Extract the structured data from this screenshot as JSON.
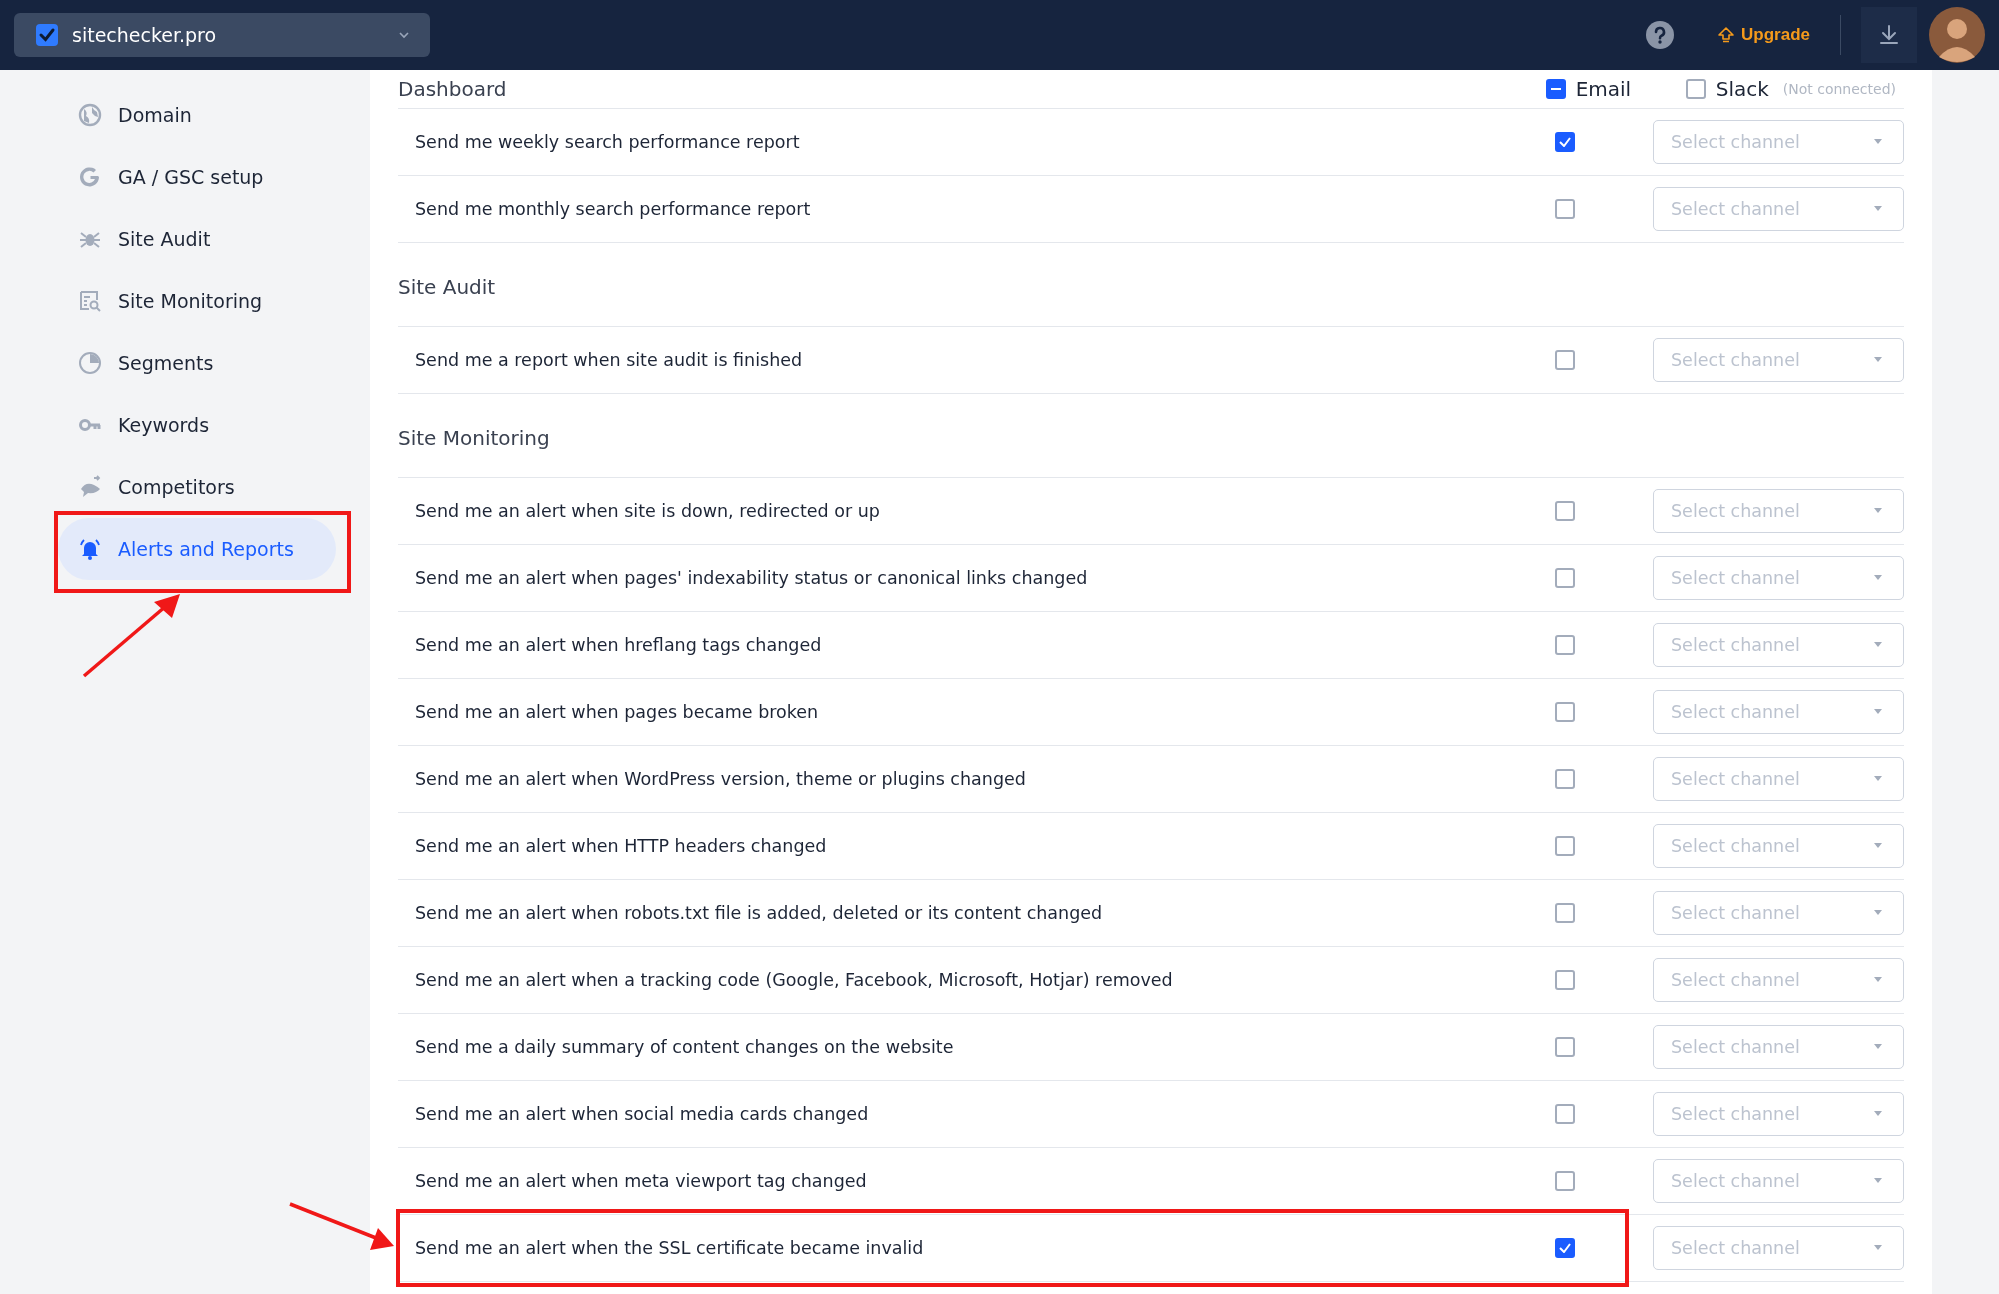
{
  "topbar": {
    "site": "sitechecker.pro",
    "upgrade": "Upgrade"
  },
  "sidebar": {
    "items": [
      {
        "label": "Domain",
        "selected": false
      },
      {
        "label": "GA / GSC setup",
        "selected": false
      },
      {
        "label": "Site Audit",
        "selected": false
      },
      {
        "label": "Site Monitoring",
        "selected": false
      },
      {
        "label": "Segments",
        "selected": false
      },
      {
        "label": "Keywords",
        "selected": false
      },
      {
        "label": "Competitors",
        "selected": false
      },
      {
        "label": "Alerts and Reports",
        "selected": true
      }
    ]
  },
  "columns": {
    "email": {
      "label": "Email",
      "checked": true,
      "partial": true
    },
    "slack": {
      "label": "Slack",
      "note": "(Not connected)",
      "checked": false
    }
  },
  "sections": [
    {
      "title": "Dashboard",
      "rows": [
        {
          "label": "Send me weekly search performance report",
          "checked": true,
          "channel": "Select channel"
        },
        {
          "label": "Send me monthly search performance report",
          "checked": false,
          "channel": "Select channel"
        }
      ]
    },
    {
      "title": "Site Audit",
      "rows": [
        {
          "label": "Send me a report when site audit is finished",
          "checked": false,
          "channel": "Select channel"
        }
      ]
    },
    {
      "title": "Site Monitoring",
      "rows": [
        {
          "label": "Send me an alert when site is down, redirected or up",
          "checked": false,
          "channel": "Select channel"
        },
        {
          "label": "Send me an alert when pages' indexability status or canonical links changed",
          "checked": false,
          "channel": "Select channel"
        },
        {
          "label": "Send me an alert when hreflang tags changed",
          "checked": false,
          "channel": "Select channel"
        },
        {
          "label": "Send me an alert when pages became broken",
          "checked": false,
          "channel": "Select channel"
        },
        {
          "label": "Send me an alert when WordPress version, theme or plugins changed",
          "checked": false,
          "channel": "Select channel"
        },
        {
          "label": "Send me an alert when HTTP headers changed",
          "checked": false,
          "channel": "Select channel"
        },
        {
          "label": "Send me an alert when robots.txt file is added, deleted or its content changed",
          "checked": false,
          "channel": "Select channel"
        },
        {
          "label": "Send me an alert when a tracking code (Google, Facebook, Microsoft, Hotjar) removed",
          "checked": false,
          "channel": "Select channel"
        },
        {
          "label": "Send me a daily summary of content changes on the website",
          "checked": false,
          "channel": "Select channel"
        },
        {
          "label": "Send me an alert when social media cards changed",
          "checked": false,
          "channel": "Select channel"
        },
        {
          "label": "Send me an alert when meta viewport tag changed",
          "checked": false,
          "channel": "Select channel"
        },
        {
          "label": "Send me an alert when the SSL certificate became invalid",
          "checked": true,
          "channel": "Select channel"
        }
      ]
    }
  ]
}
